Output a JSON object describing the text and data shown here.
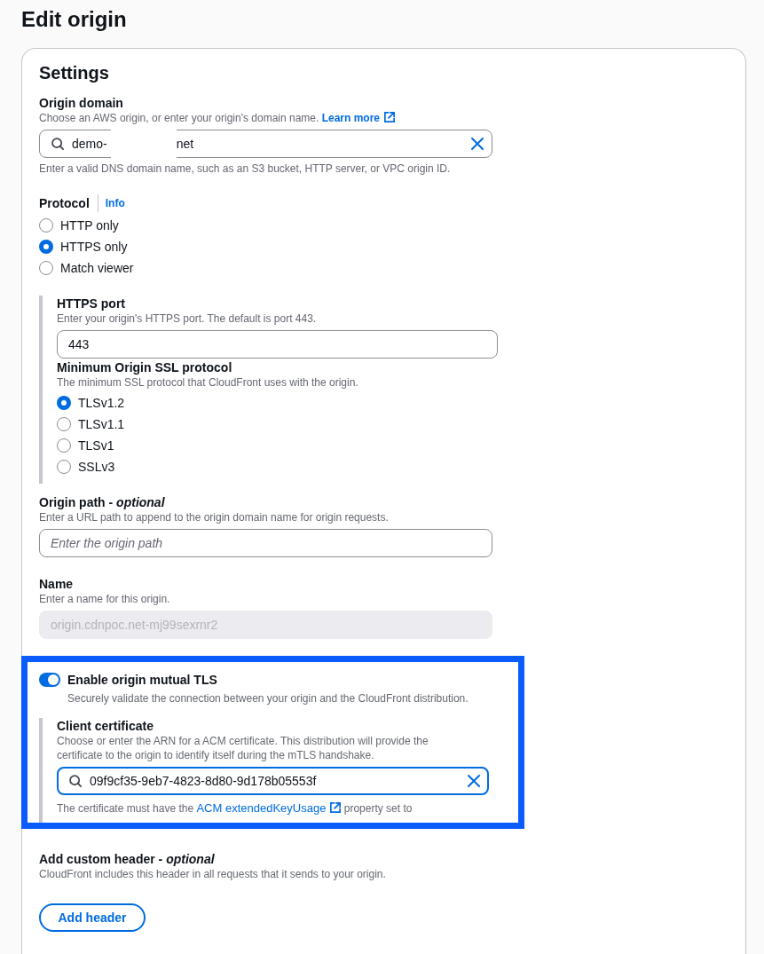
{
  "page": {
    "title": "Edit origin"
  },
  "settings": {
    "title": "Settings",
    "origin_domain": {
      "label": "Origin domain",
      "description": "Choose an AWS origin, or enter your origin's domain name.",
      "link": "Learn more",
      "value_start": "demo-",
      "value_end": "net",
      "redacted": true,
      "hint": "Enter a valid DNS domain name, such as an S3 bucket, HTTP server, or VPC origin ID."
    },
    "protocol": {
      "label": "Protocol",
      "info_link": "Info",
      "options": [
        {
          "label": "HTTP only",
          "selected": false
        },
        {
          "label": "HTTPS only",
          "selected": true
        },
        {
          "label": "Match viewer",
          "selected": false
        }
      ]
    },
    "https_port": {
      "label": "HTTPS port",
      "description": "Enter your origin's HTTPS port. The default is port 443.",
      "value": "443"
    },
    "min_ssl": {
      "label": "Minimum Origin SSL protocol",
      "description": "The minimum SSL protocol that CloudFront uses with the origin.",
      "options": [
        {
          "label": "TLSv1.2",
          "selected": true
        },
        {
          "label": "TLSv1.1",
          "selected": false
        },
        {
          "label": "TLSv1",
          "selected": false
        },
        {
          "label": "SSLv3",
          "selected": false
        }
      ]
    },
    "origin_path": {
      "label": "Origin path - *optional*",
      "description": "Enter a URL path to append to the origin domain name for origin requests.",
      "placeholder": "Enter the origin path"
    },
    "name": {
      "label": "Name",
      "description": "Enter a name for this origin.",
      "value": "origin.cdnpoc.net-mj99sexrnr2",
      "disabled": true
    },
    "mutual_tls": {
      "highlighted": true,
      "enabled": true,
      "label": "Enable origin mutual TLS",
      "description": "Securely validate the connection between your origin and the CloudFront distribution.",
      "client_certificate": {
        "label": "Client certificate",
        "description": "Choose or enter the ARN for a ACM certificate. This distribution will provide the certificate to the origin to identify itself during the mTLS handshake.",
        "value": "09f9cf35-9eb7-4823-8d80-9d178b05553f",
        "focused": true,
        "hint_before": "The certificate must have the",
        "hint_link": "ACM extendedKeyUsage",
        "hint_after": "property set to"
      }
    },
    "custom_header": {
      "label": "Add custom header - *optional*",
      "description": "CloudFront includes this header in all requests that it sends to your origin.",
      "button": "Add header"
    }
  }
}
